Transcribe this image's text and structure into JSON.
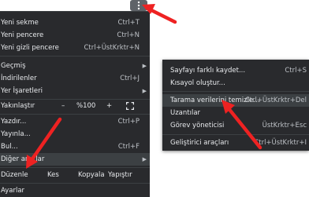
{
  "colors": {
    "menu_bg": "#292a2d",
    "highlight": "#3c4043",
    "annotation_arrow": "#ee2222"
  },
  "kebab_icon": "vertical-ellipsis-icon",
  "menu": {
    "new_tab": {
      "label": "Yeni sekme",
      "shortcut": "Ctrl+T"
    },
    "new_window": {
      "label": "Yeni pencere",
      "shortcut": "Ctrl+N"
    },
    "new_incognito": {
      "label": "Yeni gizli pencere",
      "shortcut": "Ctrl+ÜstKrktr+N"
    },
    "history": {
      "label": "Geçmiş"
    },
    "downloads": {
      "label": "İndirilenler",
      "shortcut": "Ctrl+J"
    },
    "bookmarks": {
      "label": "Yer İşaretleri"
    },
    "zoom": {
      "label": "Yakınlaştır",
      "minus": "–",
      "value": "%100",
      "plus": "+"
    },
    "print": {
      "label": "Yazdır...",
      "shortcut": "Ctrl+P"
    },
    "cast": {
      "label": "Yayınla..."
    },
    "find": {
      "label": "Bul...",
      "shortcut": "Ctrl+F"
    },
    "more_tools": {
      "label": "Diğer araçlar"
    },
    "edit": {
      "label": "Düzenle",
      "cut": "Kes",
      "copy": "Kopyala",
      "paste": "Yapıştır"
    },
    "settings": {
      "label": "Ayarlar"
    }
  },
  "submenu": {
    "save_page": {
      "label": "Sayfayı farklı kaydet...",
      "shortcut": "Ctrl+S"
    },
    "create_shortcut": {
      "label": "Kısayol oluştur..."
    },
    "clear_data": {
      "label": "Tarama verilerini temizle...",
      "shortcut": "Ctrl+ÜstKrktr+Del"
    },
    "extensions": {
      "label": "Uzantılar"
    },
    "task_manager": {
      "label": "Görev yöneticisi",
      "shortcut": "ÜstKrktr+Esc"
    },
    "dev_tools": {
      "label": "Geliştirici araçları",
      "shortcut": "Ctrl+ÜstKrktr+I"
    }
  }
}
